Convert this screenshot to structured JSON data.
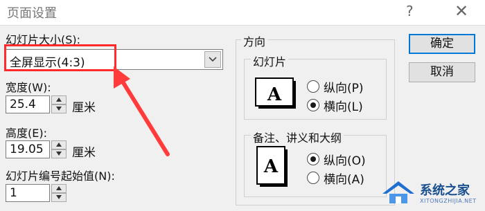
{
  "window": {
    "title": "页面设置",
    "help_glyph": "?",
    "close_glyph": "✕"
  },
  "slide_size": {
    "label": "幻灯片大小(S):",
    "value": "全屏显示(4:3)"
  },
  "width": {
    "label": "宽度(W):",
    "value": "25.4",
    "unit": "厘米"
  },
  "height": {
    "label": "高度(E):",
    "value": "19.05",
    "unit": "厘米"
  },
  "start_number": {
    "label": "幻灯片编号起始值(N):",
    "value": "1"
  },
  "orientation": {
    "title": "方向",
    "slides": {
      "title": "幻灯片",
      "icon_letter": "A",
      "portrait_label": "纵向(P)",
      "landscape_label": "横向(L)",
      "selected": "landscape"
    },
    "notes": {
      "title": "备注、讲义和大纲",
      "icon_letter": "A",
      "portrait_label": "纵向(O)",
      "landscape_label": "横向(A)",
      "selected": "portrait"
    }
  },
  "buttons": {
    "ok": "确定",
    "cancel": "取消"
  },
  "watermark": {
    "text": "系统之家",
    "sub": "XITONGZHIJIA.NET"
  },
  "colors": {
    "highlight": "#ff2a2a",
    "accent": "#0078d7"
  }
}
